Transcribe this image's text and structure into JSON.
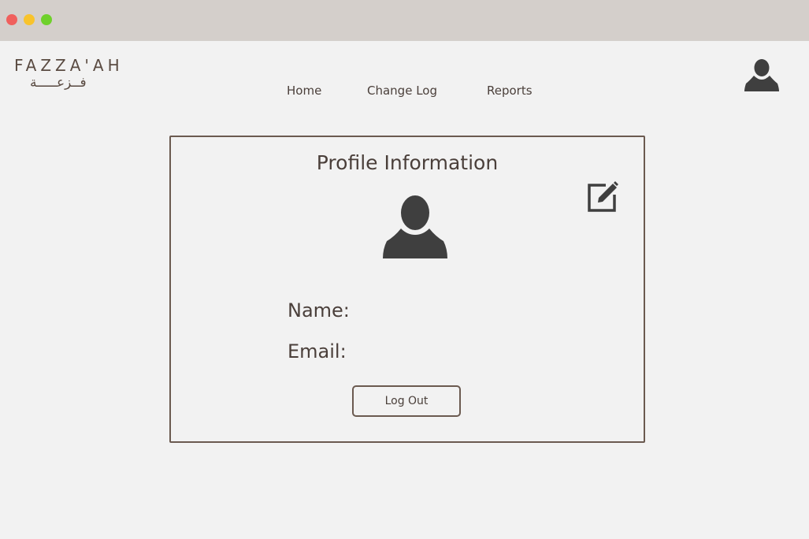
{
  "window": {
    "controls": [
      "close-dot",
      "minimize-dot",
      "maximize-dot"
    ]
  },
  "brand": {
    "latin": "FAZZA'AH",
    "arabic": "فــزعـــــة"
  },
  "nav": {
    "home": "Home",
    "change_log": "Change Log",
    "reports": "Reports"
  },
  "header": {
    "avatar_icon": "user-icon"
  },
  "profile": {
    "title": "Profile Information",
    "avatar_icon": "user-icon",
    "edit_icon": "edit-icon",
    "name_label": "Name:",
    "email_label": "Email:",
    "logout_label": "Log Out"
  },
  "colors": {
    "text": "#4a3f3a",
    "border": "#6b5a50",
    "icon": "#3f3f3f",
    "background": "#f2f2f2",
    "titlebar": "#d4cfcb"
  }
}
